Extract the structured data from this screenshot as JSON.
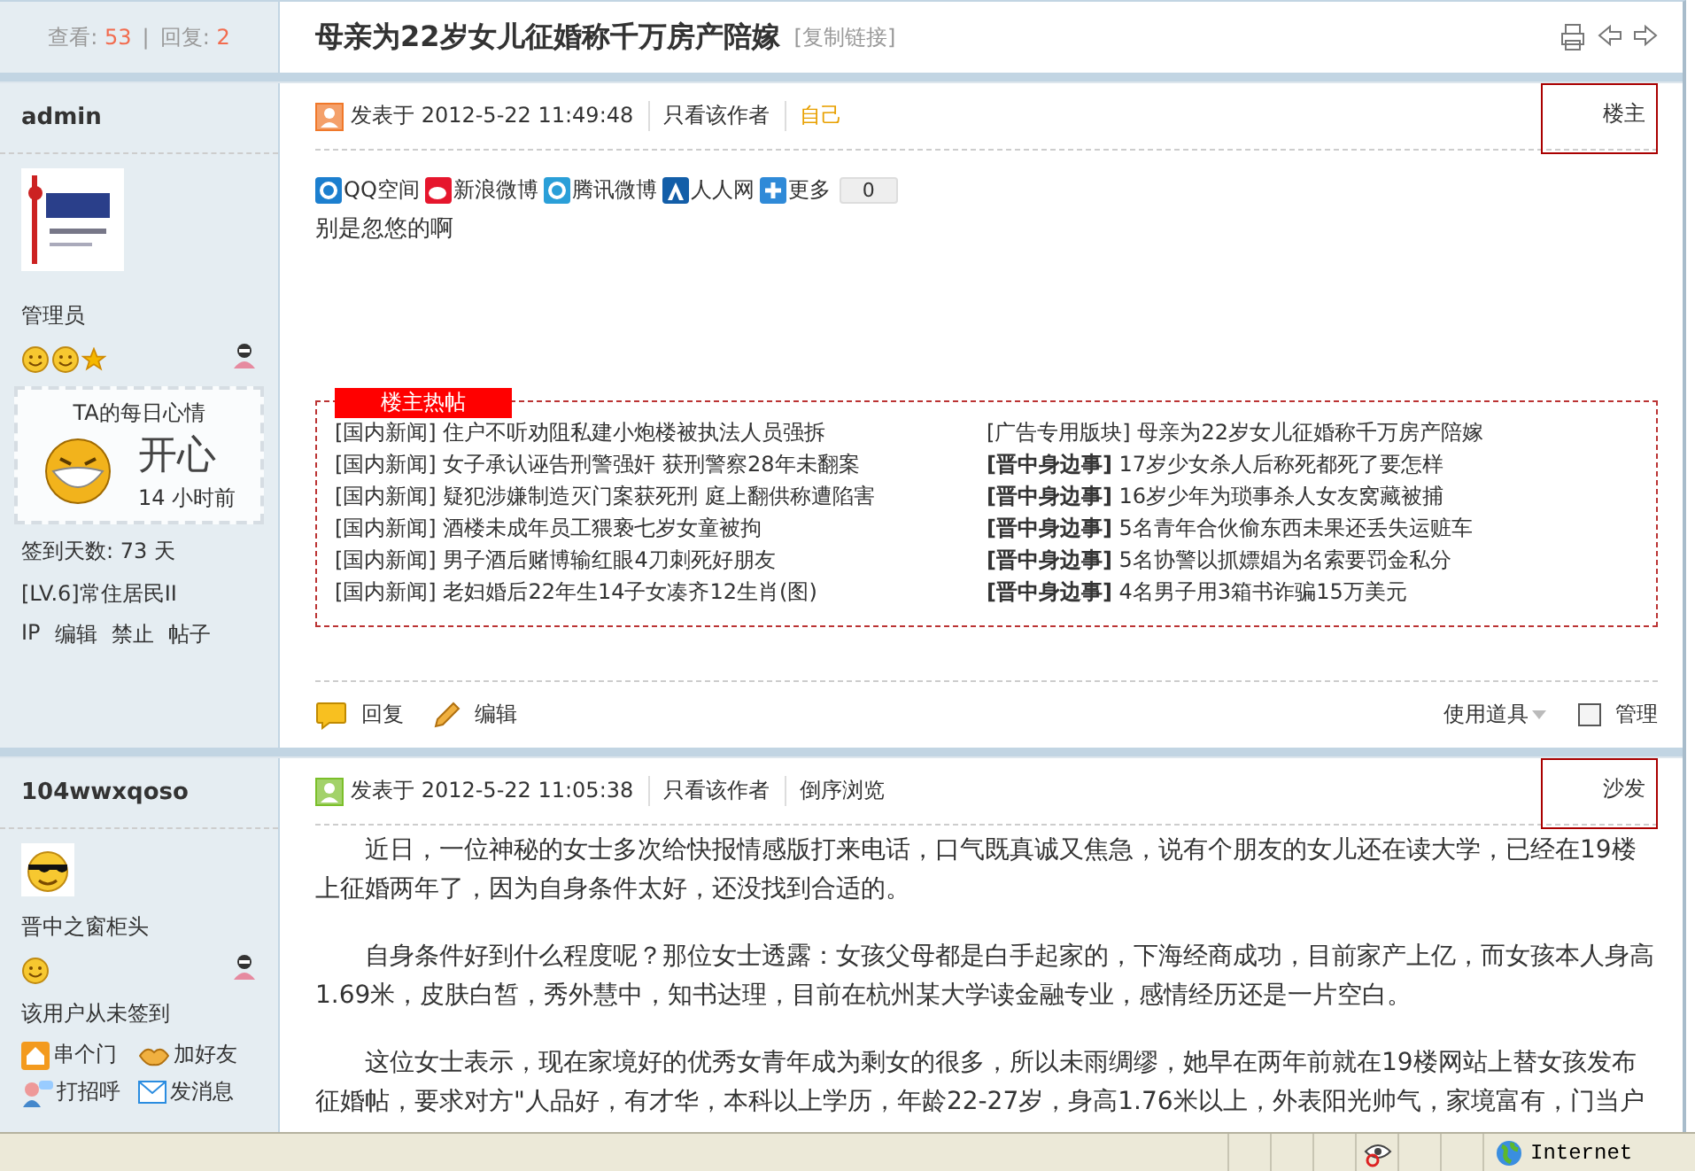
{
  "thread": {
    "views_label": "查看:",
    "views": "53",
    "separator": "|",
    "replies_label": "回复:",
    "replies": "2",
    "title": "母亲为22岁女儿征婚称千万房产陪嫁",
    "copy_link": "[复制链接]"
  },
  "posts": [
    {
      "author": {
        "name": "admin",
        "role": "管理员",
        "mood": {
          "title": "TA的每日心情",
          "mood": "开心",
          "time": "14 小时前"
        },
        "stats": [
          "签到天数: 73 天",
          "[LV.6]常住居民II"
        ],
        "actions": [
          "IP",
          "编辑",
          "禁止",
          "帖子"
        ]
      },
      "meta": {
        "posted": "发表于 2012-5-22 11:49:48",
        "links": [
          {
            "label": "只看该作者",
            "kind": "plain"
          },
          {
            "label": "自己",
            "kind": "accent"
          }
        ],
        "floor": "楼主"
      },
      "share": {
        "items": [
          "QQ空间",
          "新浪微博",
          "腾讯微博",
          "人人网",
          "更多"
        ],
        "count": "0"
      },
      "body": [
        "别是忽悠的啊"
      ],
      "hot": {
        "title": "楼主热帖",
        "columns": [
          [
            {
              "tag": "[国内新闻]",
              "tag_bold": false,
              "title": "住户不听劝阻私建小炮楼被执法人员强拆"
            },
            {
              "tag": "[国内新闻]",
              "tag_bold": false,
              "title": "女子承认诬告刑警强奸 获刑警察28年未翻案"
            },
            {
              "tag": "[国内新闻]",
              "tag_bold": false,
              "title": "疑犯涉嫌制造灭门案获死刑 庭上翻供称遭陷害"
            },
            {
              "tag": "[国内新闻]",
              "tag_bold": false,
              "title": "酒楼未成年员工猥亵七岁女童被拘"
            },
            {
              "tag": "[国内新闻]",
              "tag_bold": false,
              "title": "男子酒后赌博输红眼4刀刺死好朋友"
            },
            {
              "tag": "[国内新闻]",
              "tag_bold": false,
              "title": "老妇婚后22年生14子女凑齐12生肖(图)"
            }
          ],
          [
            {
              "tag": "[广告专用版块]",
              "tag_bold": false,
              "title": "母亲为22岁女儿征婚称千万房产陪嫁"
            },
            {
              "tag": "[晋中身边事]",
              "tag_bold": true,
              "title": "17岁少女杀人后称死都死了要怎样"
            },
            {
              "tag": "[晋中身边事]",
              "tag_bold": true,
              "title": "16岁少年为琐事杀人女友窝藏被捕"
            },
            {
              "tag": "[晋中身边事]",
              "tag_bold": true,
              "title": "5名青年合伙偷东西未果还丢失运赃车"
            },
            {
              "tag": "[晋中身边事]",
              "tag_bold": true,
              "title": "5名协警以抓嫖娼为名索要罚金私分"
            },
            {
              "tag": "[晋中身边事]",
              "tag_bold": true,
              "title": "4名男子用3箱书诈骗15万美元"
            }
          ]
        ]
      },
      "footer": {
        "reply": "回复",
        "edit": "编辑",
        "tools": "使用道具",
        "manage": {
          "label": "管理",
          "checked": false
        }
      }
    },
    {
      "author": {
        "name": "104wwxqoso",
        "role": "晋中之窗柜头",
        "stats": [
          "该用户从未签到"
        ],
        "contacts": [
          "串个门",
          "加好友",
          "打招呼",
          "发消息"
        ]
      },
      "meta": {
        "posted": "发表于 2012-5-22 11:05:38",
        "links": [
          {
            "label": "只看该作者",
            "kind": "plain"
          },
          {
            "label": "倒序浏览",
            "kind": "plain"
          }
        ],
        "floor": "沙发"
      },
      "body": [
        "近日，一位神秘的女士多次给快报情感版打来电话，口气既真诚又焦急，说有个朋友的女儿还在读大学，已经在19楼上征婚两年了，因为自身条件太好，还没找到合适的。",
        "自身条件好到什么程度呢？那位女士透露：女孩父母都是白手起家的，下海经商成功，目前家产上亿，而女孩本人身高1.69米，皮肤白皙，秀外慧中，知书达理，目前在杭州某大学读金融专业，感情经历还是一片空白。",
        "这位女士表示，现在家境好的优秀女青年成为剩女的很多，所以未雨绸缪，她早在两年前就在19楼网站上替女孩发布征婚帖，要求对方\"人品好，有才华，本科以上学历，年龄22-27岁，身高1.76米以上，外表阳光帅气，家境富有，门当户"
      ]
    }
  ],
  "status_bar": {
    "zone": "Internet"
  }
}
